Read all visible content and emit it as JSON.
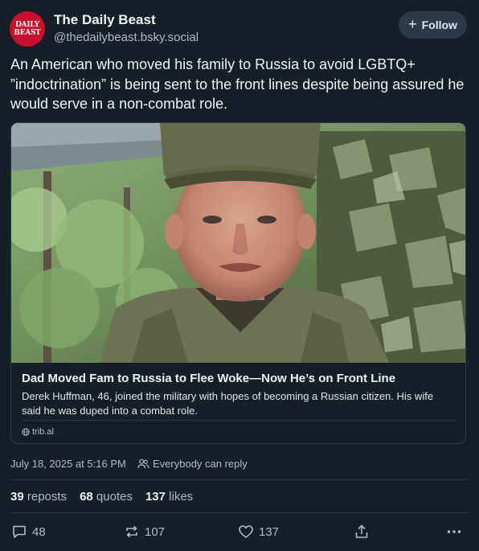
{
  "author": {
    "name": "The Daily Beast",
    "handle": "@thedailybeast.bsky.social",
    "avatar_text": "DAILY BEAST",
    "avatar_color": "#c8102e"
  },
  "follow_button": {
    "icon": "plus-icon",
    "label": "Follow"
  },
  "post": {
    "text": "An American who moved his family to Russia to avoid LGBTQ+ ”indoctrination” is being sent to the front lines despite being assured he would serve in a non-combat role.",
    "timestamp": "July 18, 2025 at 5:16 PM",
    "reply_setting": "Everybody can reply"
  },
  "link_card": {
    "title": "Dad Moved Fam to Russia to Flee Woke—Now He’s on Front Line",
    "description": "Derek Huffman, 46, joined the military with hopes of becoming a Russian citizen. His wife said he was duped into a combat role.",
    "domain": "trib.al",
    "image_alt": "man in camouflage military uniform and cap in front of camouflage netting"
  },
  "stats": {
    "reposts_count": "39",
    "reposts_label": "reposts",
    "quotes_count": "68",
    "quotes_label": "quotes",
    "likes_count": "137",
    "likes_label": "likes"
  },
  "actions": {
    "reply_count": "48",
    "repost_count": "107",
    "like_count": "137"
  },
  "colors": {
    "background": "#161e27",
    "text_primary": "#f1f3f5",
    "text_secondary": "#aebbc9",
    "border": "#2e3b4a",
    "follow_bg": "#2d3947"
  }
}
